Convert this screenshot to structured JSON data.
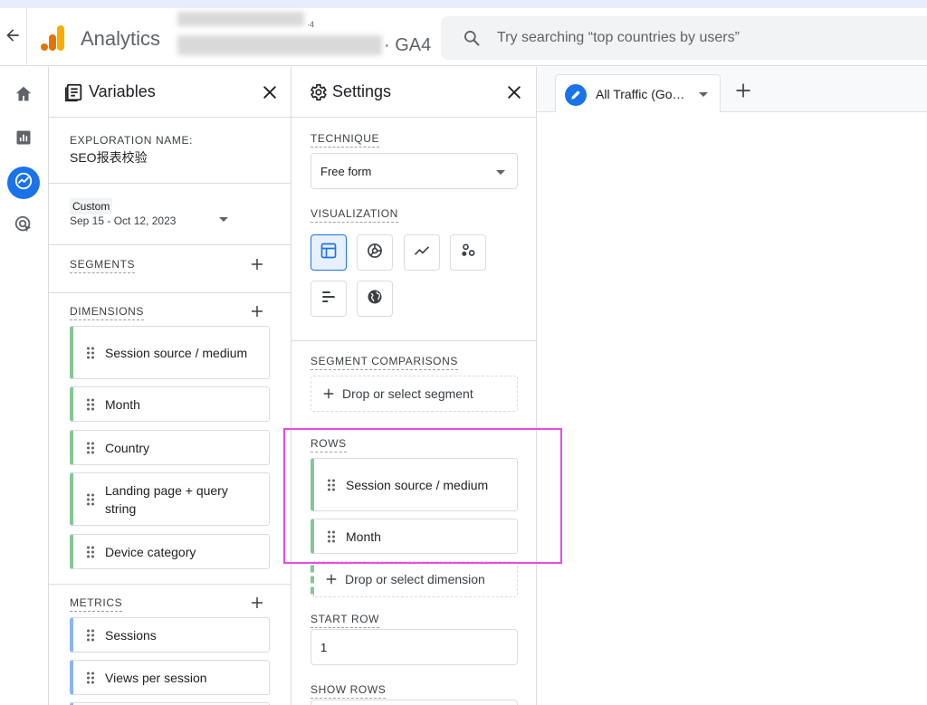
{
  "header": {
    "app_title": "Analytics",
    "account_small": "·4",
    "property_name": "· GA4",
    "search_placeholder": "Try searching “top countries by users”"
  },
  "variables": {
    "title": "Variables",
    "exploration_label": "EXPLORATION NAME:",
    "exploration_name": "SEO报表校验",
    "date_custom": "Custom",
    "date_range": "Sep 15 - Oct 12, 2023",
    "segments_label": "SEGMENTS",
    "dimensions_label": "DIMENSIONS",
    "dimensions": [
      "Session source / medium",
      "Month",
      "Country",
      "Landing page + query string",
      "Device category"
    ],
    "metrics_label": "METRICS",
    "metrics": [
      "Sessions",
      "Views per session"
    ]
  },
  "settings": {
    "title": "Settings",
    "technique_label": "TECHNIQUE",
    "technique_value": "Free form",
    "visualization_label": "VISUALIZATION",
    "segment_comparisons_label": "SEGMENT COMPARISONS",
    "segment_drop": "Drop or select segment",
    "rows_label": "ROWS",
    "rows": [
      "Session source / medium",
      "Month"
    ],
    "dimension_drop": "Drop or select dimension",
    "start_row_label": "START ROW",
    "start_row_value": "1",
    "show_rows_label": "SHOW ROWS"
  },
  "tabs": {
    "active_label": "All Traffic (Go…"
  },
  "colors": {
    "accent": "#1a73e8",
    "dimension_chip": "#81c995",
    "metric_chip": "#8ab4f8",
    "highlight": "#e94be6"
  }
}
